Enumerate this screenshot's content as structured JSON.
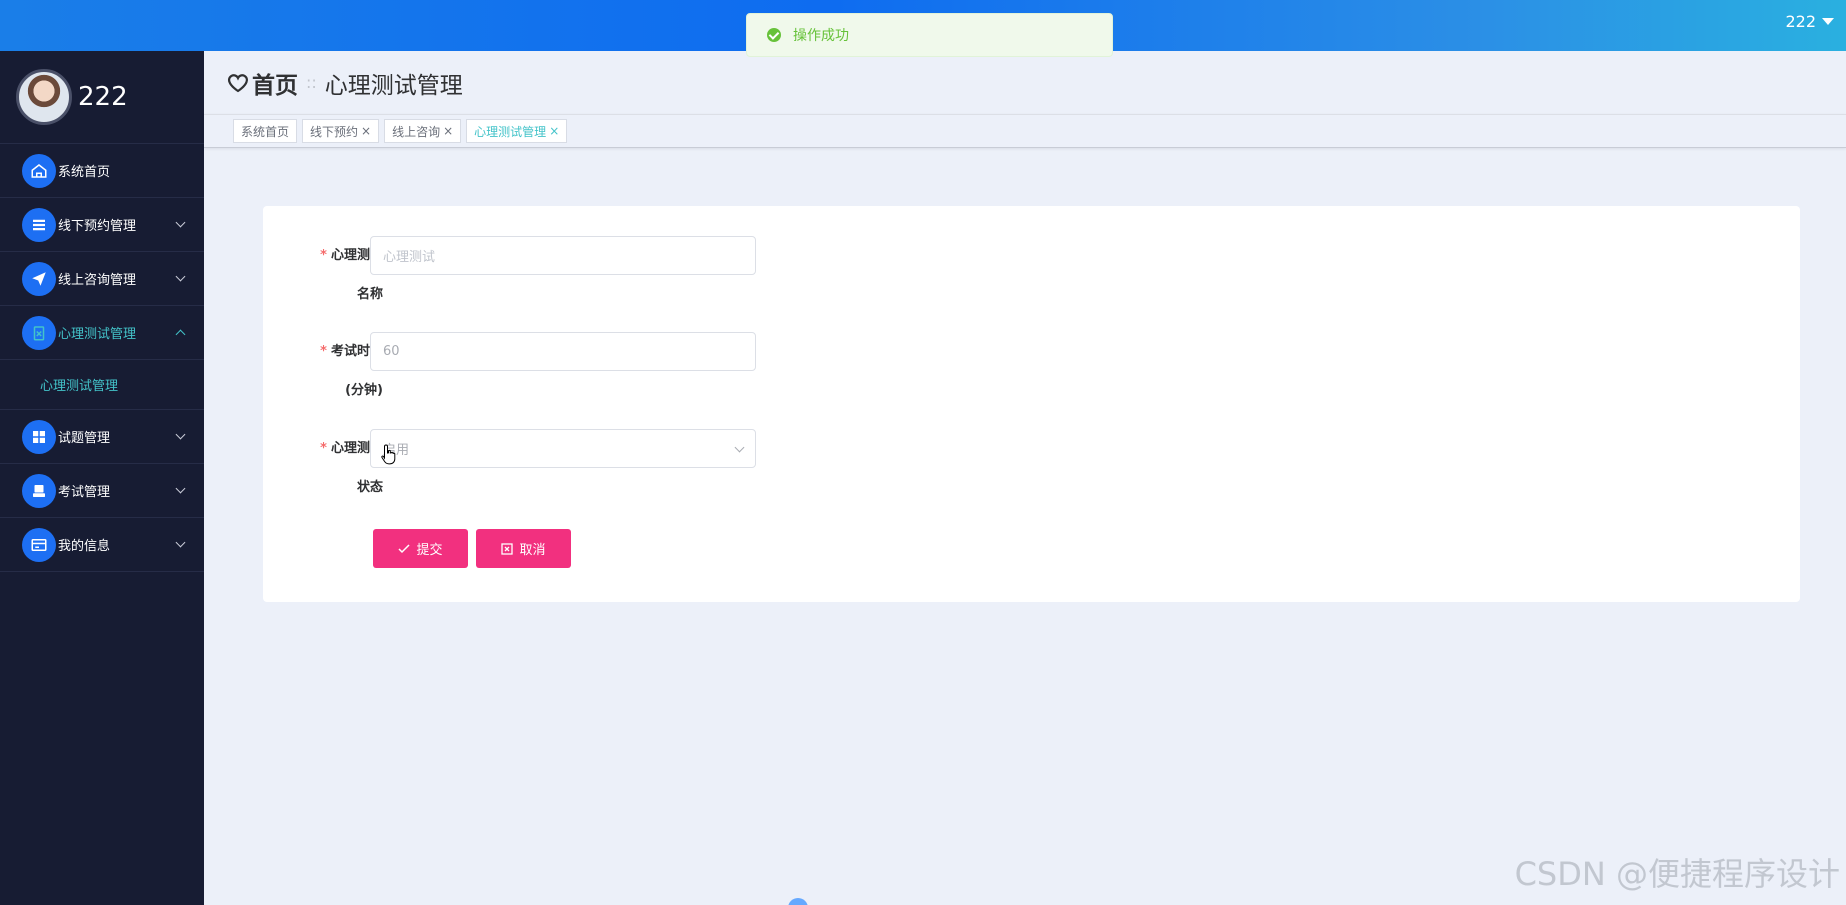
{
  "topbar": {
    "username": "222"
  },
  "toast": {
    "message": "操作成功"
  },
  "sidebar": {
    "profile_name": "222",
    "items": [
      {
        "label": "系统首页",
        "icon": "home-icon"
      },
      {
        "label": "线下预约管理",
        "icon": "list-icon"
      },
      {
        "label": "线上咨询管理",
        "icon": "send-icon"
      },
      {
        "label": "心理测试管理",
        "icon": "clipboard-icon",
        "active": true
      },
      {
        "label": "试题管理",
        "icon": "grid-icon"
      },
      {
        "label": "考试管理",
        "icon": "printer-icon"
      },
      {
        "label": "我的信息",
        "icon": "card-icon"
      }
    ],
    "submenu_label": "心理测试管理"
  },
  "breadcrumb": {
    "home": "首页",
    "separator": "::",
    "current": "心理测试管理"
  },
  "tabs": [
    {
      "label": "系统首页",
      "closable": false
    },
    {
      "label": "线下预约",
      "closable": true
    },
    {
      "label": "线上咨询",
      "closable": true
    },
    {
      "label": "心理测试管理",
      "closable": true,
      "active": true
    }
  ],
  "form": {
    "fields": [
      {
        "label_line1": "心理测试",
        "label_line2": "名称",
        "placeholder": "心理测试",
        "value": ""
      },
      {
        "label_line1": "考试时长",
        "label_line2": "(分钟)",
        "placeholder": "",
        "value": "60"
      },
      {
        "label_line1": "心理测试",
        "label_line2": "状态",
        "value": "启用"
      }
    ],
    "submit_label": "提交",
    "cancel_label": "取消"
  },
  "watermark": "CSDN @便捷程序设计",
  "colors": {
    "accent": "#1d6ff3",
    "active_text": "#43c3c9",
    "button": "#f2307f",
    "sidebar_bg": "#171c33"
  }
}
